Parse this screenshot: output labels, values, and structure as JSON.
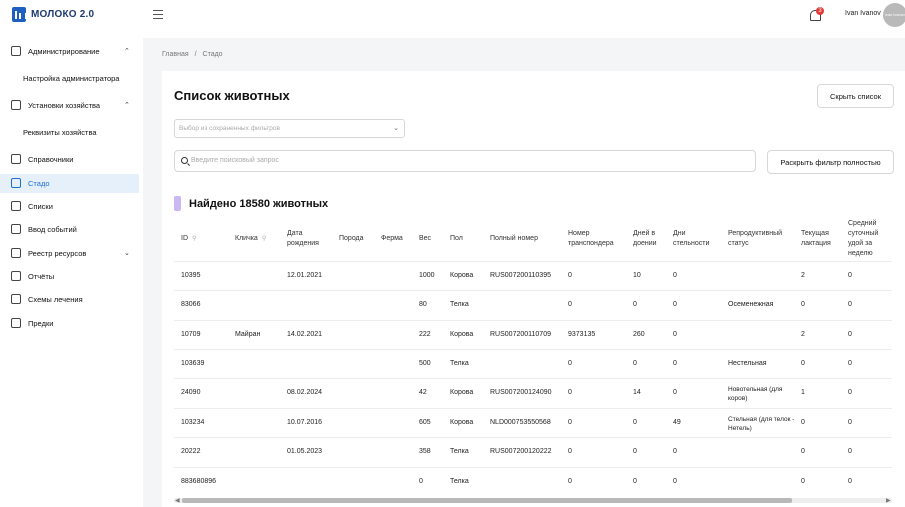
{
  "app": {
    "name": "МОЛОКО 2.0"
  },
  "header": {
    "user_name": "Ivan Ivanov",
    "notification_count": "3",
    "avatar_text": "ivan ivanov"
  },
  "sidebar": {
    "items": [
      {
        "label": "Администрирование",
        "icon": "key-icon",
        "expanded": true
      },
      {
        "label": "Настройка администратора",
        "sub": true
      },
      {
        "label": "Установки хозяйства",
        "icon": "tag-icon",
        "expanded": true
      },
      {
        "label": "Реквизиты хозяйства",
        "sub": true
      },
      {
        "label": "Справочники",
        "icon": "book-icon"
      },
      {
        "label": "Стадо",
        "icon": "cow-icon",
        "active": true
      },
      {
        "label": "Списки",
        "icon": "list-icon"
      },
      {
        "label": "Ввод событий",
        "icon": "events-icon"
      },
      {
        "label": "Реестр ресурсов",
        "icon": "resources-icon",
        "expandable": true
      },
      {
        "label": "Отчёты",
        "icon": "report-icon"
      },
      {
        "label": "Схемы лечения",
        "icon": "treatment-icon"
      },
      {
        "label": "Предки",
        "icon": "ancestors-icon"
      }
    ]
  },
  "breadcrumb": {
    "home": "Главная",
    "separator": "/",
    "current": "Стадо"
  },
  "main": {
    "title": "Список животных",
    "hide_list_button": "Скрыть список",
    "saved_filters_placeholder": "Выбор из сохраненных фильтров",
    "search_placeholder": "Введите поисковый запрос",
    "expand_filter_button": "Раскрыть фильтр полностью",
    "found_text": "Найдено 18580 животных"
  },
  "table": {
    "columns": [
      "ID",
      "Кличка",
      "Дата рождения",
      "Порода",
      "Ферма",
      "Вес",
      "Пол",
      "Полный номер",
      "Номер транспондера",
      "Дней в доении",
      "Дни стельности",
      "Репродуктивный статус",
      "Текущая лактация",
      "Средний суточный удой за неделю"
    ],
    "rows": [
      [
        "10395",
        "",
        "12.01.2021",
        "",
        "",
        "1000",
        "Корова",
        "RUS007200110395",
        "0",
        "10",
        "0",
        "",
        "2",
        "0"
      ],
      [
        "83066",
        "",
        "",
        "",
        "",
        "80",
        "Телка",
        "",
        "0",
        "0",
        "0",
        "Осеменежная",
        "0",
        "0"
      ],
      [
        "10709",
        "Майран",
        "14.02.2021",
        "",
        "",
        "222",
        "Корова",
        "RUS007200110709",
        "9373135",
        "260",
        "0",
        "",
        "2",
        "0"
      ],
      [
        "103639",
        "",
        "",
        "",
        "",
        "500",
        "Телка",
        "",
        "0",
        "0",
        "0",
        "Нестельная",
        "0",
        "0"
      ],
      [
        "24090",
        "",
        "08.02.2024",
        "",
        "",
        "42",
        "Корова",
        "RUS007200124090",
        "0",
        "14",
        "0",
        "Новотельная (для коров)",
        "1",
        "0"
      ],
      [
        "103234",
        "",
        "10.07.2016",
        "",
        "",
        "605",
        "Корова",
        "NLD000753550568",
        "0",
        "0",
        "49",
        "Стельная (для телок - Нетель)",
        "0",
        "0"
      ],
      [
        "20222",
        "",
        "01.05.2023",
        "",
        "",
        "358",
        "Телка",
        "RUS007200120222",
        "0",
        "0",
        "0",
        "",
        "0",
        "0"
      ],
      [
        "883680896",
        "",
        "",
        "",
        "",
        "0",
        "Телка",
        "",
        "0",
        "0",
        "0",
        "",
        "0",
        "0"
      ]
    ]
  },
  "colors": {
    "accent": "#1d6fd1",
    "active_bg": "#e6f0fb",
    "found_marker": "#c9b8f2",
    "badge": "#e53935"
  }
}
